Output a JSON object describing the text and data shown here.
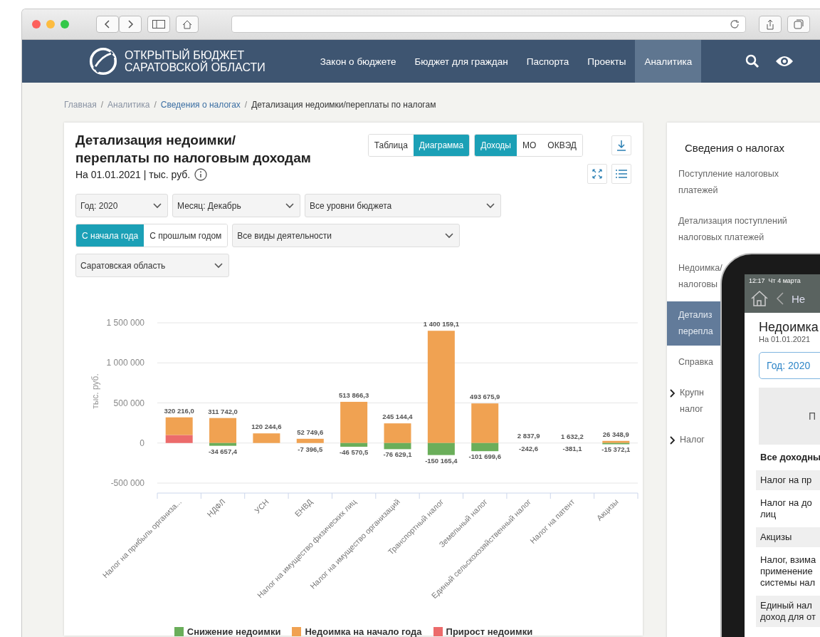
{
  "header": {
    "logo_lines": [
      "ОТКРЫТЫЙ БЮДЖЕТ",
      "САРАТОВСКОЙ ОБЛАСТИ"
    ],
    "nav": [
      {
        "label": "Закон о бюджете",
        "selected": false
      },
      {
        "label": "Бюджет для граждан",
        "selected": false
      },
      {
        "label": "Паспорта",
        "selected": false
      },
      {
        "label": "Проекты",
        "selected": false
      },
      {
        "label": "Аналитика",
        "selected": true
      }
    ]
  },
  "breadcrumb_separator": "/",
  "breadcrumbs": [
    {
      "label": "Главная",
      "kind": "muted"
    },
    {
      "label": "Аналитика",
      "kind": "muted"
    },
    {
      "label": "Сведения о налогах",
      "kind": "link"
    },
    {
      "label": "Детализация недоимки/переплаты по налогам",
      "kind": "current"
    }
  ],
  "report": {
    "title_lines": [
      "Детализация недоимки/",
      "переплаты по налоговым доходам"
    ],
    "subtitle": "На 01.01.2021 | тыс. руб.",
    "view_toggle": [
      {
        "label": "Таблица",
        "selected": false
      },
      {
        "label": "Диаграмма",
        "selected": true
      }
    ],
    "dimension_toggle": [
      {
        "label": "Доходы",
        "selected": true
      },
      {
        "label": "МО",
        "selected": false
      },
      {
        "label": "ОКВЭД",
        "selected": false
      }
    ],
    "filter_rows": [
      [
        {
          "kind": "select",
          "value": "Год: 2020"
        },
        {
          "kind": "select",
          "value": "Месяц: Декабрь"
        },
        {
          "kind": "select",
          "value": "Все уровни бюджета"
        }
      ],
      [
        {
          "kind": "toggle",
          "options": [
            {
              "label": "С начала года",
              "selected": true
            },
            {
              "label": "С прошлым годом",
              "selected": false
            }
          ]
        },
        {
          "kind": "select",
          "value": "Все виды деятельности"
        }
      ],
      [
        {
          "kind": "select",
          "value": "Саратовская область"
        }
      ]
    ],
    "chart": {
      "chart_data": {
        "type": "bar",
        "stacked": true,
        "grid": true,
        "legend": "bottom",
        "ylabel": "тыс. руб.",
        "value_labels": [
          [
            null,
            "-34 657,4",
            null,
            "-7 396,5",
            "-46 570,5",
            "-76 629,1",
            "-150 165,4",
            "-101 699,6",
            "-242,6",
            "-381,1",
            "-15 372,1"
          ],
          [
            "320 216,0",
            "311 742,0",
            "120 244,6",
            "52 749,6",
            "513 866,3",
            "245 144,4",
            "1 400 159,1",
            "493 675,9",
            "2 837,9",
            "1 632,2",
            "26 348,9"
          ]
        ],
        "categories": [
          "Налог на прибыль организа...",
          "НДФЛ",
          "УСН",
          "ЕНВД",
          "Налог на имущество физических лиц",
          "Налог на имущество организаций",
          "Транспортный налог",
          "Земельный налог",
          "Единый сельскохозяйственный налог",
          "Налог на патент",
          "Акцизы"
        ],
        "ylim": [
          -500000,
          1500000
        ],
        "yticks": [
          {
            "value": -500000,
            "label": "-500 000"
          },
          {
            "value": 0,
            "label": "0"
          },
          {
            "value": 500000,
            "label": "500 000"
          },
          {
            "value": 1000000,
            "label": "1 000 000"
          },
          {
            "value": 1500000,
            "label": "1 500 000"
          }
        ],
        "series": [
          {
            "name": "Снижение недоимки",
            "color": "#6aae5a",
            "values": [
              null,
              -34657.4,
              null,
              -7396.5,
              -46570.5,
              -76629.1,
              -150165.4,
              -101699.6,
              -242.6,
              -381.1,
              -15372.1
            ]
          },
          {
            "name": "Недоимка на начало года",
            "color": "#f0a252",
            "values": [
              220216,
              311742,
              120244.6,
              52749.6,
              513866.3,
              245144.4,
              1400159.1,
              493675.9,
              2837.9,
              1632.2,
              26348.9
            ]
          },
          {
            "name": "Прирост недоимки",
            "color": "#ec6b6b",
            "values": [
              100000,
              null,
              null,
              null,
              null,
              null,
              null,
              null,
              null,
              null,
              null
            ]
          }
        ]
      }
    }
  },
  "sidebar": {
    "title": "Сведения о налогах",
    "items": [
      {
        "lines": [
          "Поступление налоговых",
          "платежей"
        ],
        "selected": false,
        "expandable": false
      },
      {
        "lines": [
          "Детализация поступлений",
          "налоговых платежей"
        ],
        "selected": false,
        "expandable": false
      },
      {
        "lines": [
          "Недоимка/",
          "налоговы"
        ],
        "selected": false,
        "expandable": false
      },
      {
        "lines": [
          "Детализ",
          "перепла"
        ],
        "selected": true,
        "expandable": false
      },
      {
        "lines": [
          "Справка"
        ],
        "selected": false,
        "expandable": false
      },
      {
        "lines": [
          "Крупн",
          "налог"
        ],
        "selected": false,
        "expandable": true
      },
      {
        "lines": [
          "Налог"
        ],
        "selected": false,
        "expandable": true
      }
    ]
  },
  "phone": {
    "time": "12:17",
    "date": "Чт 4 марта",
    "header_title": "Не",
    "title": "Недоимка",
    "subtitle": "На 01.01.2021",
    "year_field": "Год: 2020",
    "panel_text": "П",
    "rows": [
      {
        "kind": "total",
        "lines": [
          "Все доходны"
        ]
      },
      {
        "kind": "item",
        "lines": [
          "Налог на пр"
        ]
      },
      {
        "kind": "item",
        "lines": [
          "Налог на до",
          "лиц"
        ]
      },
      {
        "kind": "item",
        "lines": [
          "Акцизы"
        ]
      },
      {
        "kind": "item",
        "lines": [
          "Налог, взима",
          "применение",
          "системы нал"
        ]
      },
      {
        "kind": "item",
        "lines": [
          "Единый нал",
          "доход для от"
        ]
      }
    ]
  }
}
